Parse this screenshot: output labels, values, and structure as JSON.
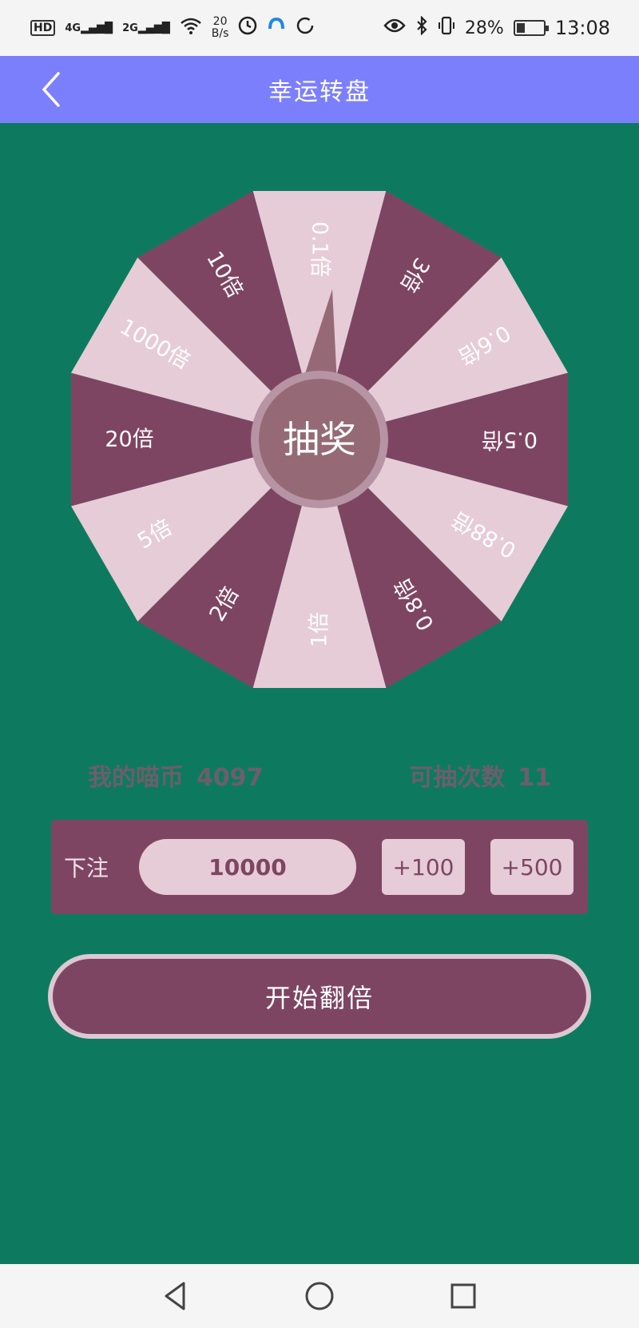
{
  "status_bar": {
    "hd": "HD",
    "net1": "4G",
    "net2": "2G",
    "speed_value": "20",
    "speed_unit": "B/s",
    "battery": "28%",
    "battery_level": 0.28,
    "time": "13:08"
  },
  "app_bar": {
    "title": "幸运转盘"
  },
  "wheel": {
    "center_label": "抽奖",
    "colors": {
      "dark": "#7e4563",
      "light": "#e6ccd6",
      "hub": "#956a76",
      "hub_ring": "#b694a3"
    },
    "segments": [
      "0.1倍",
      "3倍",
      "0.6倍",
      "0.5倍",
      "0.88倍",
      "0.8倍",
      "1倍",
      "2倍",
      "5倍",
      "20倍",
      "1000倍",
      "10倍"
    ]
  },
  "info": {
    "coins_label": "我的喵币",
    "coins_value": "4097",
    "draws_label": "可抽次数",
    "draws_value": "11"
  },
  "bet": {
    "label": "下注",
    "value": "10000",
    "add100_label": "+100",
    "add500_label": "+500"
  },
  "start_button": {
    "label": "开始翻倍"
  },
  "colors": {
    "background": "#0d7a5f",
    "app_bar": "#7b7ffc",
    "accent": "#7e4563",
    "accent_light": "#e6ccd6"
  }
}
